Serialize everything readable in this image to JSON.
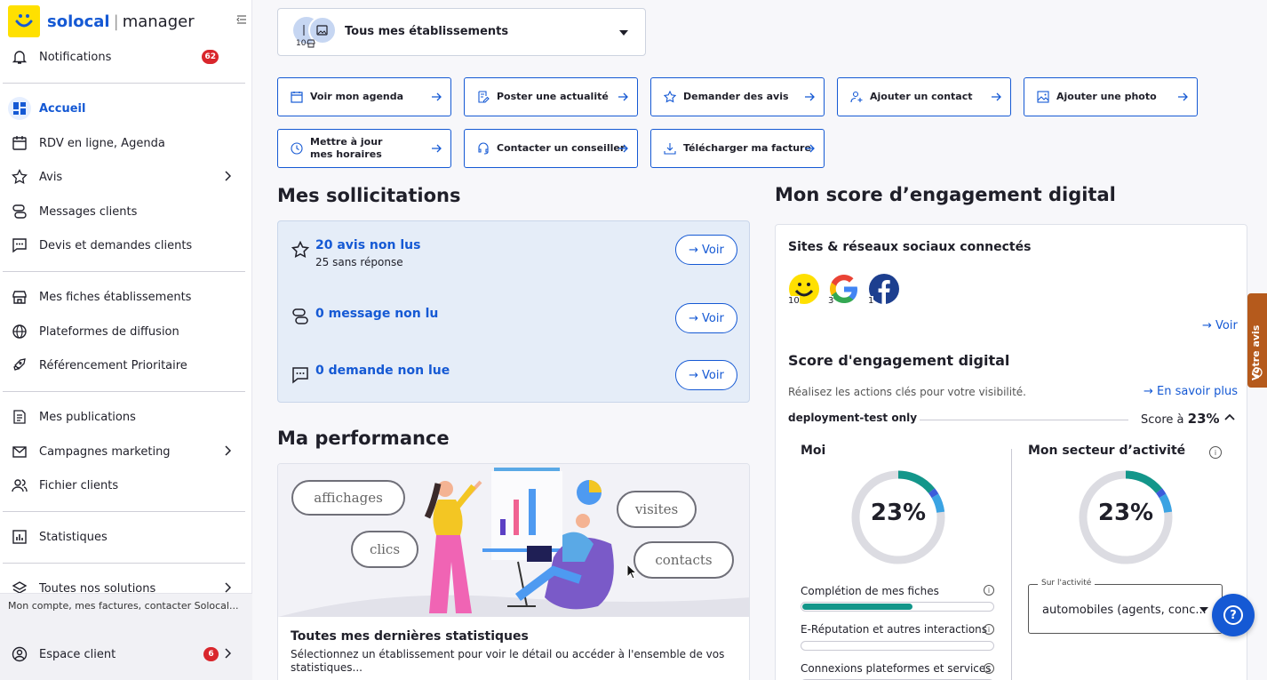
{
  "brand": {
    "name": "solocal",
    "product": "manager"
  },
  "sidebar": {
    "notifications": {
      "label": "Notifications",
      "count": "62"
    },
    "items": [
      {
        "label": "Accueil"
      },
      {
        "label": "RDV en ligne, Agenda"
      },
      {
        "label": "Avis"
      },
      {
        "label": "Messages clients"
      },
      {
        "label": "Devis et demandes clients"
      },
      {
        "label": "Mes fiches établissements"
      },
      {
        "label": "Plateformes de diffusion"
      },
      {
        "label": "Référencement Prioritaire"
      },
      {
        "label": "Mes publications"
      },
      {
        "label": "Campagnes marketing"
      },
      {
        "label": "Fichier clients"
      },
      {
        "label": "Statistiques"
      },
      {
        "label": "Toutes nos solutions"
      }
    ],
    "account_hint": "Mon compte, mes factures, contacter Solocal...",
    "espace_client": {
      "label": "Espace client",
      "count": "6"
    }
  },
  "selector": {
    "label": "Tous mes établissements",
    "count": "10"
  },
  "quick_actions": [
    {
      "label": "Voir mon agenda",
      "icon": "calendar-icon"
    },
    {
      "label": "Poster une actualité",
      "icon": "edit-icon"
    },
    {
      "label": "Demander des avis",
      "icon": "star-icon"
    },
    {
      "label": "Ajouter un contact",
      "icon": "person-add-icon"
    },
    {
      "label": "Ajouter une photo",
      "icon": "image-icon"
    },
    {
      "label": "Mettre à jour mes horaires",
      "icon": "clock-icon"
    },
    {
      "label": "Contacter un conseiller",
      "icon": "headset-icon"
    },
    {
      "label": "Télécharger ma facture",
      "icon": "download-icon"
    }
  ],
  "sollicitations": {
    "title": "Mes sollicitations",
    "rows": [
      {
        "title": "20 avis non lus",
        "sub": "25 sans réponse",
        "button": "Voir"
      },
      {
        "title": "0 message non lu",
        "button": "Voir"
      },
      {
        "title": "0 demande non lue",
        "button": "Voir"
      }
    ]
  },
  "performance": {
    "title": "Ma performance",
    "bubbles": [
      "affichages",
      "clics",
      "visites",
      "contacts"
    ],
    "stats_title": "Toutes mes dernières statistiques",
    "stats_desc": "Sélectionnez un établissement pour voir le détail ou accéder à l'ensemble de vos statistiques..."
  },
  "engagement": {
    "title": "Mon score d’engagement digital",
    "sites_title": "Sites & réseaux sociaux connectés",
    "sites": [
      {
        "name": "solocal",
        "count": "10"
      },
      {
        "name": "google",
        "count": "3"
      },
      {
        "name": "facebook",
        "count": "1"
      }
    ],
    "voir": "Voir",
    "score_title": "Score d'engagement digital",
    "score_desc": "Réalisez les actions clés pour votre visibilité.",
    "learn_more": "En savoir plus",
    "establishment": "deployment-test only",
    "score_label": "Score à",
    "score_value": "23%",
    "me": {
      "title": "Moi",
      "value": "23%",
      "fraction": 0.23
    },
    "sector": {
      "title": "Mon secteur d’activité",
      "value": "23%",
      "fraction": 0.23
    },
    "progress": [
      {
        "label": "Complétion de mes fiches",
        "value": 0.58
      },
      {
        "label": "E-Réputation et autres interactions",
        "value": 0
      },
      {
        "label": "Connexions plateformes et services",
        "value": 0
      }
    ],
    "activity_legend": "Sur l'activité",
    "activity_value": "automobiles (agents, conc..."
  },
  "votre_avis": "Votre avis",
  "help": "?",
  "colors": {
    "primary": "#1559d4",
    "teal": "#13968a",
    "badge": "#d9262c",
    "orange": "#b55a1c",
    "yellow": "#ffe000"
  }
}
